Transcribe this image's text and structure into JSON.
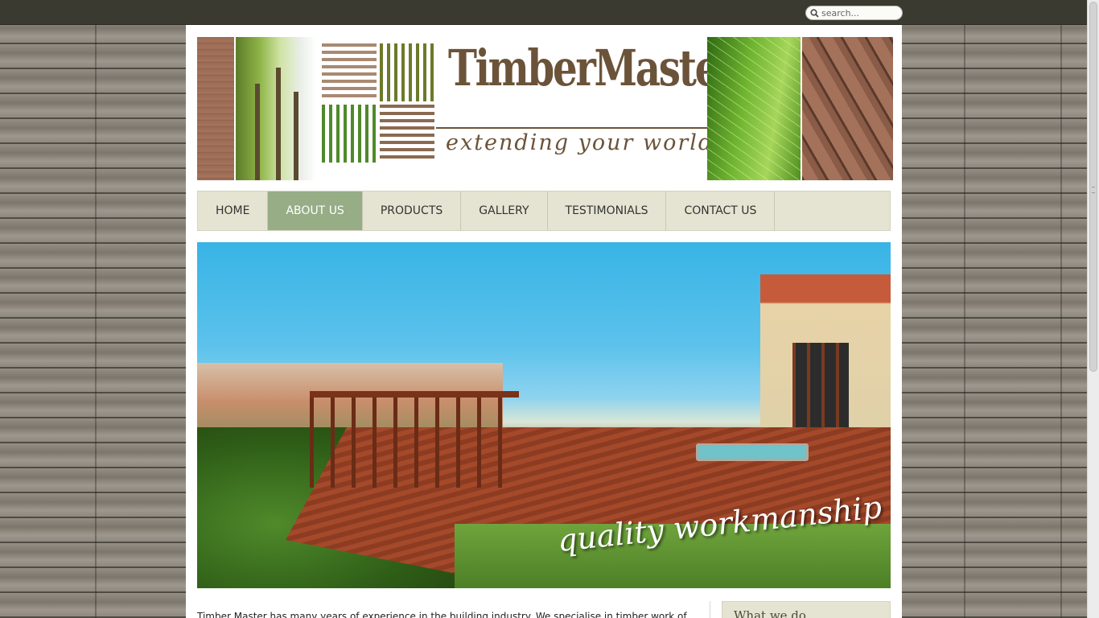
{
  "search": {
    "placeholder": "search..."
  },
  "brand": {
    "name": "TimberMaster",
    "tagline": "extending your world"
  },
  "nav": {
    "items": [
      {
        "label": "HOME",
        "active": false
      },
      {
        "label": "ABOUT US",
        "active": true
      },
      {
        "label": "PRODUCTS",
        "active": false
      },
      {
        "label": "GALLERY",
        "active": false
      },
      {
        "label": "TESTIMONIALS",
        "active": false
      },
      {
        "label": "CONTACT US",
        "active": false
      }
    ],
    "active_color": "#96ad86",
    "bar_color": "#e5e4d2"
  },
  "hero": {
    "caption": "quality workmanship"
  },
  "content": {
    "intro": "Timber Master has many years of experience in the building industry. We specialise in timber work of"
  },
  "sidebar": {
    "title": "What we do"
  },
  "colors": {
    "topbar": "#3b3a30",
    "logo_brown": "#6b5339"
  }
}
